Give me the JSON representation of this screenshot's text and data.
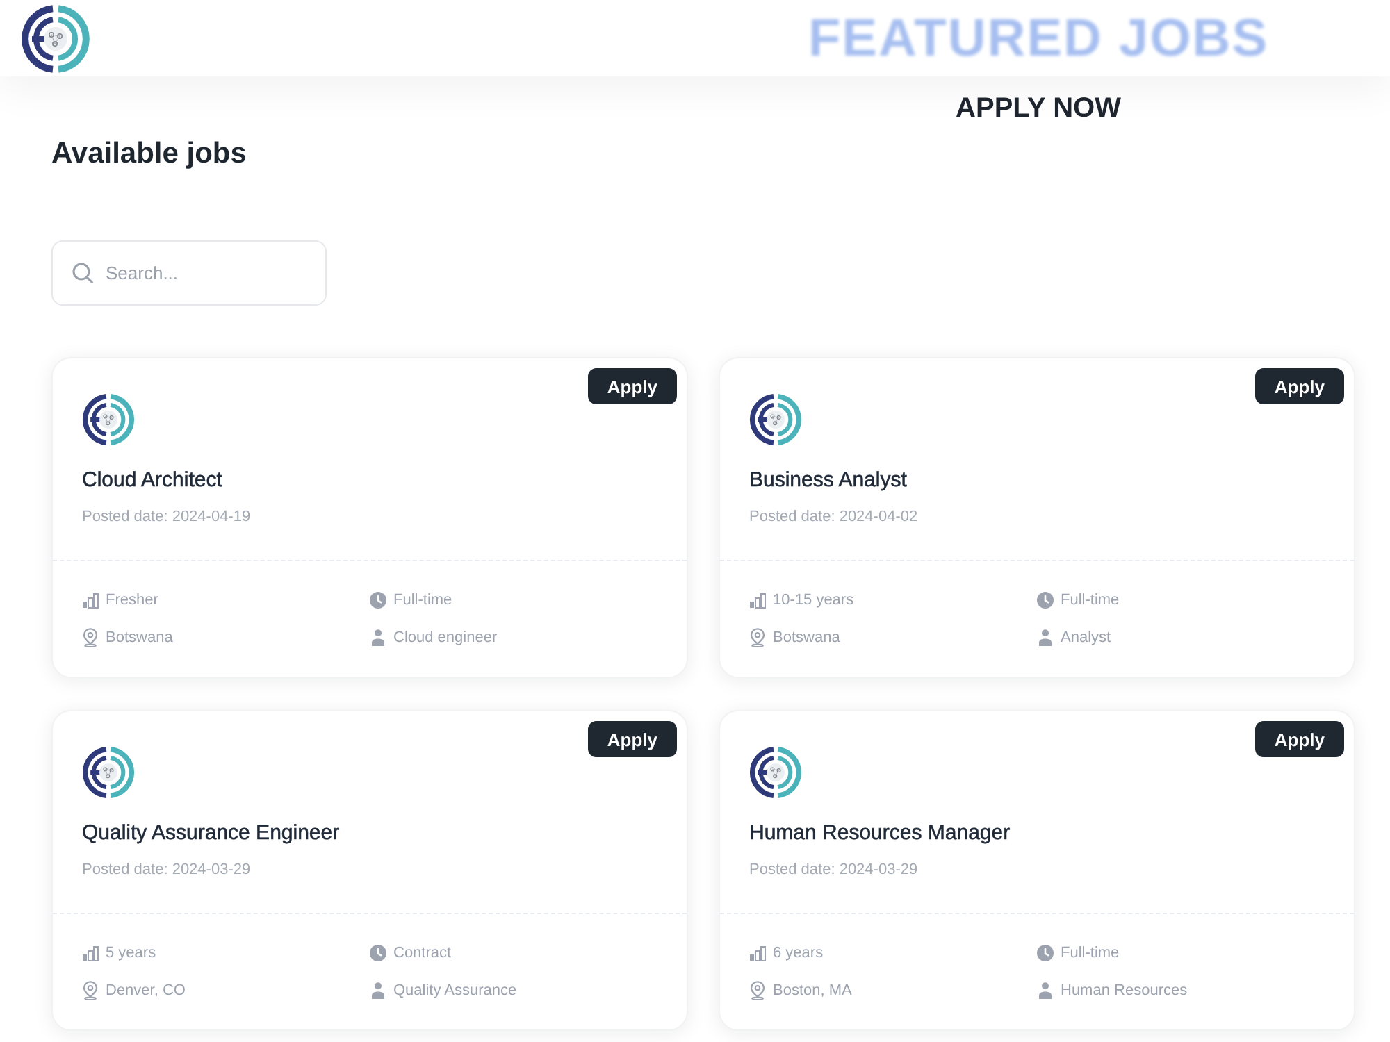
{
  "header": {
    "featured_title": "FEATURED JOBS",
    "cta": "APPLY NOW"
  },
  "page_title": "Available jobs",
  "search": {
    "placeholder": "Search..."
  },
  "jobs": [
    {
      "title": "Cloud Architect",
      "posted": "Posted date: 2024-04-19",
      "action": "Apply",
      "details": [
        {
          "kind": "experience",
          "text": "Fresher"
        },
        {
          "kind": "schedule",
          "text": "Full-time"
        },
        {
          "kind": "location",
          "text": "Botswana"
        },
        {
          "kind": "role",
          "text": "Cloud engineer"
        }
      ]
    },
    {
      "title": "Business Analyst",
      "posted": "Posted date: 2024-04-02",
      "action": "Apply",
      "details": [
        {
          "kind": "experience",
          "text": "10-15 years"
        },
        {
          "kind": "schedule",
          "text": "Full-time"
        },
        {
          "kind": "location",
          "text": "Botswana"
        },
        {
          "kind": "role",
          "text": "Analyst"
        }
      ]
    },
    {
      "title": "Quality Assurance Engineer",
      "posted": "Posted date: 2024-03-29",
      "action": "Apply",
      "details": [
        {
          "kind": "experience",
          "text": "5 years"
        },
        {
          "kind": "schedule",
          "text": "Contract"
        },
        {
          "kind": "location",
          "text": "Denver, CO"
        },
        {
          "kind": "role",
          "text": "Quality Assurance"
        }
      ]
    },
    {
      "title": "Human Resources Manager",
      "posted": "Posted date: 2024-03-29",
      "action": "Apply",
      "details": [
        {
          "kind": "experience",
          "text": "6 years"
        },
        {
          "kind": "schedule",
          "text": "Full-time"
        },
        {
          "kind": "location",
          "text": "Boston, MA"
        },
        {
          "kind": "role",
          "text": "Human Resources"
        }
      ]
    }
  ]
}
